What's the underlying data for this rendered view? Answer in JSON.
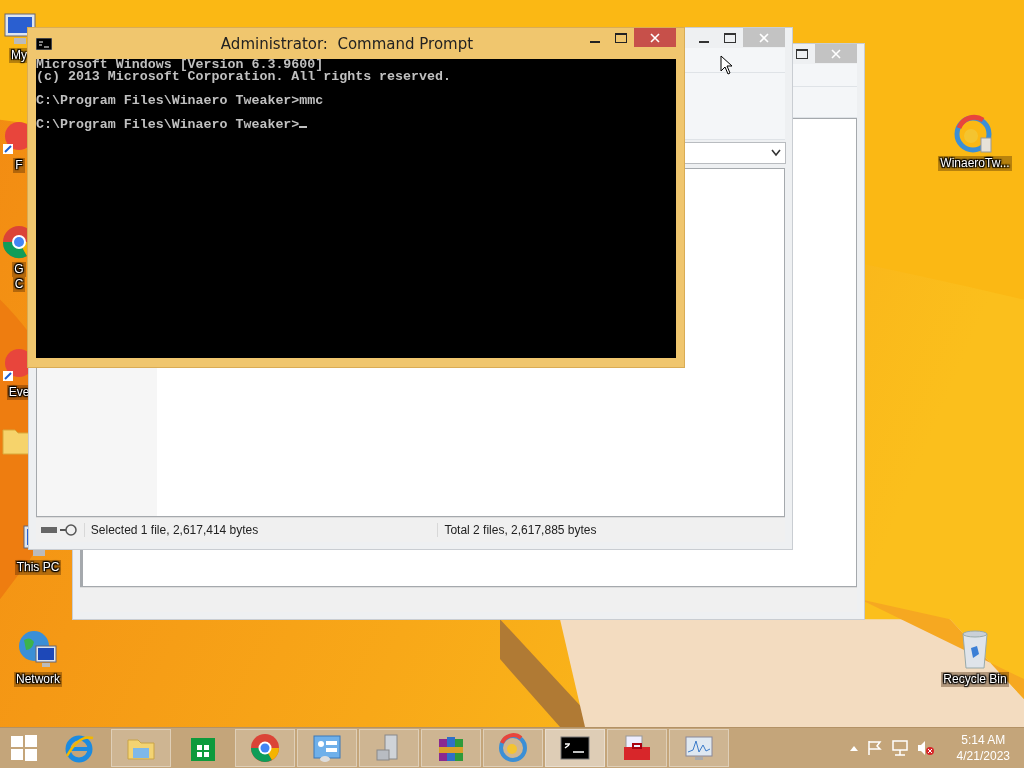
{
  "desktop_icons": [
    {
      "kind": "computer",
      "lines": [
        "My"
      ]
    },
    {
      "kind": "app",
      "lines": [
        "F"
      ]
    },
    {
      "kind": "chrome",
      "lines": [
        "G",
        "C"
      ]
    },
    {
      "kind": "app",
      "lines": [
        "Eve"
      ]
    },
    {
      "kind": "folder"
    },
    {
      "kind": "computer",
      "lines": [
        "This PC"
      ]
    },
    {
      "kind": "network",
      "lines": [
        "Network"
      ]
    },
    {
      "kind": "winaero",
      "lines": [
        "WinaeroTw..."
      ]
    },
    {
      "kind": "recycle",
      "lines": [
        "Recycle Bin"
      ]
    }
  ],
  "windows": [
    {
      "kind": "blank"
    },
    {
      "kind": "files",
      "status": [
        "Selected 1 file, 2,617,414 bytes",
        "Total 2 files, 2,617,885 bytes"
      ]
    },
    {
      "kind": "console",
      "title": "Administrator:  Command Prompt",
      "cursor": true,
      "blocks": [
        [
          "Microsoft Windows [Version 6.3.9600]",
          "(c) 2013 Microsoft Corporation. All rights reserved."
        ],
        [
          "C:\\Program Files\\Winaero Tweaker>mmc"
        ],
        [
          "C:\\Program Files\\Winaero Tweaker>"
        ]
      ]
    }
  ],
  "taskbar": {
    "apps": [
      {
        "kind": "ie",
        "running": false,
        "selected": false
      },
      {
        "kind": "explorer",
        "running": true,
        "selected": false
      },
      {
        "kind": "store",
        "running": false,
        "selected": false
      },
      {
        "kind": "chrome",
        "running": true,
        "selected": false
      },
      {
        "kind": "control",
        "running": true,
        "selected": false
      },
      {
        "kind": "tower",
        "running": true,
        "selected": false
      },
      {
        "kind": "winrar",
        "running": true,
        "selected": false
      },
      {
        "kind": "winaero",
        "running": true,
        "selected": false
      },
      {
        "kind": "cmd",
        "running": true,
        "selected": true
      },
      {
        "kind": "toolbox",
        "running": true,
        "selected": false
      },
      {
        "kind": "monitor",
        "running": true,
        "selected": false
      }
    ],
    "clock": {
      "time": "5:14 AM",
      "date": "4/21/2023"
    }
  }
}
